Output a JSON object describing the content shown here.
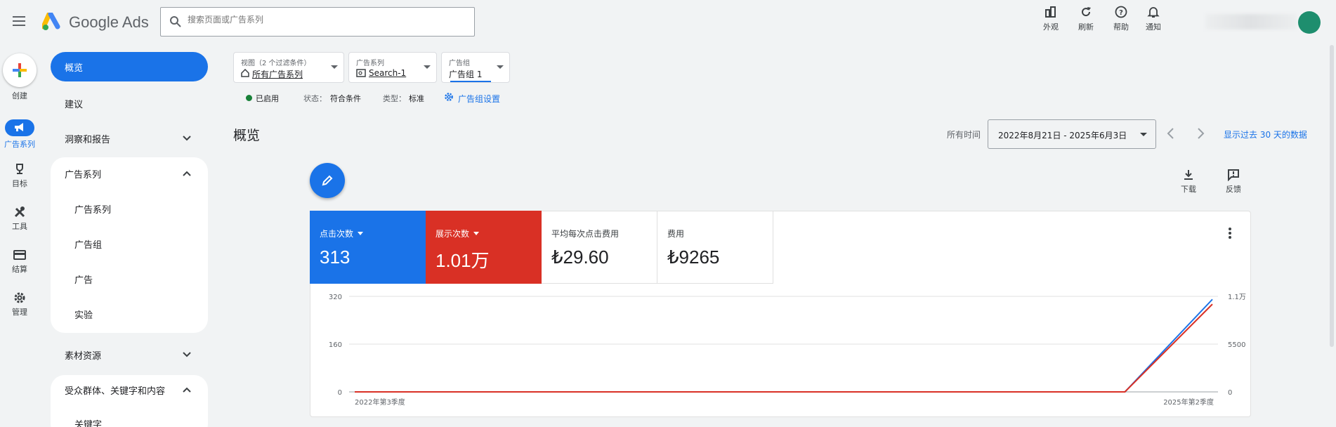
{
  "app": {
    "name": "Google Ads"
  },
  "search": {
    "placeholder": "搜索页面或广告系列"
  },
  "toolbar": {
    "appearance": "外观",
    "refresh": "刷新",
    "help": "帮助",
    "notifications": "通知"
  },
  "rail": {
    "create": "创建",
    "campaigns": "广告系列",
    "goals": "目标",
    "tools": "工具",
    "billing": "结算",
    "admin": "管理"
  },
  "nav": {
    "overview": "概览",
    "recommendations": "建议",
    "insights": "洞察和报告",
    "campaigns_group": "广告系列",
    "campaigns": "广告系列",
    "ad_groups": "广告组",
    "ads": "广告",
    "experiments": "实验",
    "assets": "素材资源",
    "audiences": "受众群体、关键字和内容",
    "keywords": "关键字"
  },
  "filters": {
    "view_label": "视图（2 个过滤条件）",
    "view_value": "所有广告系列",
    "campaign_label": "广告系列",
    "campaign_value": "Search-1",
    "adgroup_label": "广告组",
    "adgroup_value": "广告组 1"
  },
  "status_bar": {
    "enabled": "已启用",
    "status_label": "状态：",
    "status_value": "符合条件",
    "type_label": "类型：",
    "type_value": "标准",
    "settings_link": "广告组设置"
  },
  "page": {
    "title": "概览"
  },
  "date": {
    "label": "所有时间",
    "range": "2022年8月21日 - 2025年6月3日",
    "last30": "显示过去 30 天的数据"
  },
  "actions": {
    "download": "下载",
    "feedback": "反馈"
  },
  "metrics": [
    {
      "label": "点击次数",
      "value": "313",
      "color": "#1a73e8"
    },
    {
      "label": "展示次数",
      "value": "1.01万",
      "color": "#d93025"
    },
    {
      "label": "平均每次点击费用",
      "value": "₺29.60"
    },
    {
      "label": "费用",
      "value": "₺9265"
    }
  ],
  "colors": {
    "accent": "#1a73e8",
    "clicks": "#1a73e8",
    "impressions": "#d93025",
    "enabled_dot": "#188038"
  },
  "chart_data": {
    "type": "line",
    "x": [
      "2022年第3季度",
      "2025年第2季度"
    ],
    "x_tick_labels": [
      "2022年第3季度",
      "2025年第2季度"
    ],
    "series": [
      {
        "name": "点击次数",
        "axis": "left",
        "values": [
          0,
          0,
          0,
          0,
          0,
          0,
          0,
          0,
          0,
          0,
          0,
          310
        ]
      },
      {
        "name": "展示次数",
        "axis": "right",
        "values": [
          0,
          0,
          0,
          0,
          0,
          0,
          0,
          0,
          0,
          0,
          0,
          10100
        ]
      }
    ],
    "y_left": {
      "ticks": [
        "320",
        "160",
        "0"
      ],
      "ylim": [
        0,
        320
      ]
    },
    "y_right": {
      "ticks": [
        "1.1万",
        "5500",
        "0"
      ],
      "ylim": [
        0,
        11000
      ]
    },
    "grid": true
  }
}
